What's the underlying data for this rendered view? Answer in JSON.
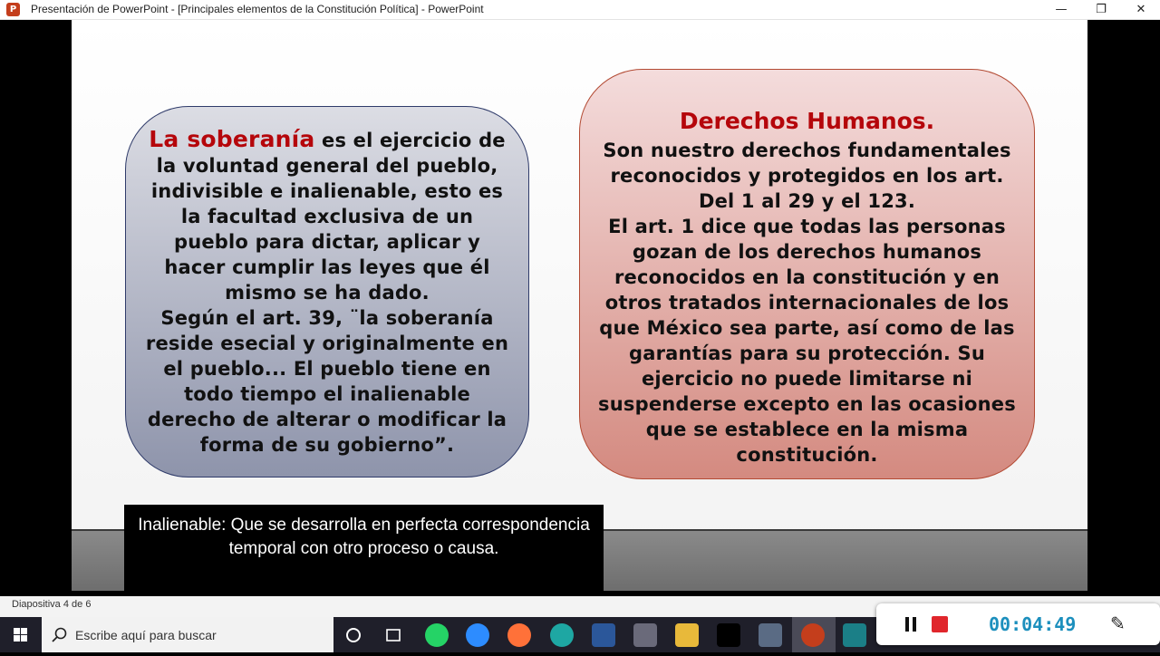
{
  "window": {
    "app_icon_letter": "P",
    "title": "Presentación de PowerPoint - [Principales elementos de la Constitución Política] - PowerPoint",
    "controls": {
      "minimize": "—",
      "restore": "❐",
      "close": "✕"
    }
  },
  "slide": {
    "left_box": {
      "highlight": "La soberanía",
      "text_after_highlight": " es el ejercicio de la voluntad general del pueblo, indivisible e inalienable, esto es la facultad exclusiva de un pueblo para dictar, aplicar y hacer cumplir las leyes que él mismo se ha dado.",
      "quote": "Según el art. 39, ¨la soberanía reside esecial y originalmente en el pueblo... El pueblo tiene en todo tiempo el inalienable derecho de alterar o modificar la forma de su gobierno”."
    },
    "right_box": {
      "heading": "Derechos Humanos.",
      "paragraph1": "Son nuestro derechos fundamentales reconocidos y protegidos en los art. Del 1 al 29 y el 123.",
      "paragraph2": "El art. 1 dice que todas las personas gozan de los derechos humanos reconocidos en la constitución y en otros tratados internacionales de los que México sea parte, así como  de las garantías para su protección. Su ejercicio no puede limitarse ni suspenderse excepto en las ocasiones que se establece en la misma constitución."
    }
  },
  "caption": "Inalienable: Que se desarrolla en perfecta correspondencia temporal con otro proceso o causa.",
  "status_bar": {
    "slide_count": "Diapositiva 4 de 6"
  },
  "taskbar": {
    "search_placeholder": "Escribe aquí para buscar",
    "apps": [
      "cortana-icon",
      "task-view-icon",
      "whatsapp-icon",
      "zoom-icon",
      "firefox-icon",
      "edge-icon",
      "word-icon",
      "store-icon",
      "file-explorer-icon",
      "netflix-icon",
      "calculator-icon",
      "powerpoint-icon",
      "camera-icon"
    ]
  },
  "recorder": {
    "time": "00:04:49",
    "stop_color": "#e0262c",
    "time_color": "#1c8fbd"
  },
  "colors": {
    "highlight_red": "#b5060b",
    "left_box_border": "#2f3b6a",
    "right_box_border": "#b34a33"
  }
}
